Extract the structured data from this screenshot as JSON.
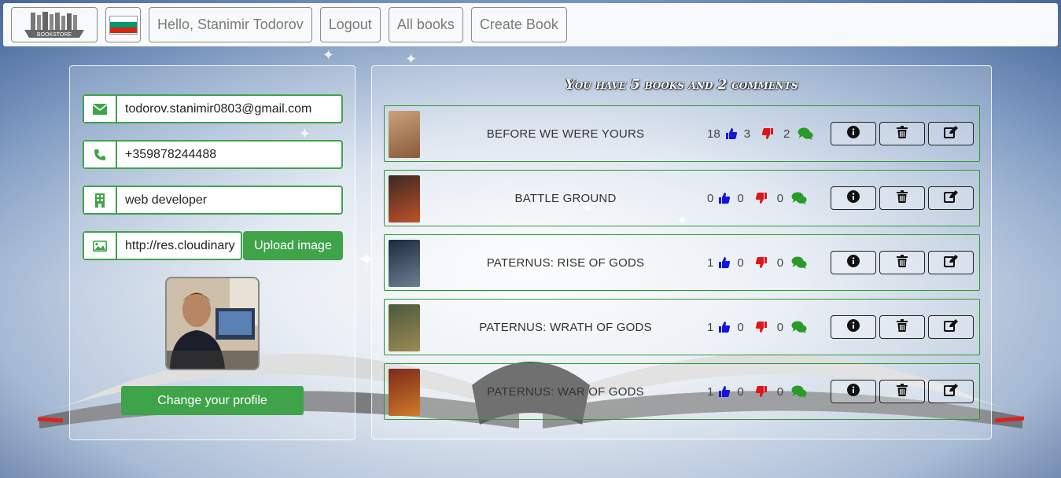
{
  "navbar": {
    "logo_text": "BOOKSTORE",
    "language_flag": "bulgaria-flag",
    "greeting": "Hello, Stanimir Todorov",
    "logout_label": "Logout",
    "all_books_label": "All books",
    "create_book_label": "Create Book"
  },
  "profile": {
    "email": "todorov.stanimir0803@gmail.com",
    "phone": "+359878244488",
    "job": "web developer",
    "image_url": "http://res.cloudinary",
    "upload_label": "Upload image",
    "change_profile_label": "Change your profile",
    "icons": [
      "envelope-icon",
      "phone-icon",
      "building-icon",
      "image-icon"
    ]
  },
  "books_summary": "You have 5 books and 2 comments",
  "books": [
    {
      "title": "BEFORE WE WERE YOURS",
      "views": "18",
      "likes": "3",
      "dislikes": "2",
      "cover_colors": [
        "#c9a27a",
        "#8a5a3a"
      ]
    },
    {
      "title": "BATTLE GROUND",
      "views": "0",
      "likes": "0",
      "dislikes": "0",
      "cover_colors": [
        "#3a2a22",
        "#c0502a"
      ]
    },
    {
      "title": "PATERNUS: RISE OF GODS",
      "views": "1",
      "likes": "0",
      "dislikes": "0",
      "cover_colors": [
        "#1c2a3e",
        "#6f7f92"
      ]
    },
    {
      "title": "PATERNUS: WRATH OF GODS",
      "views": "1",
      "likes": "0",
      "dislikes": "0",
      "cover_colors": [
        "#4a5a3a",
        "#9c8a56"
      ]
    },
    {
      "title": "PATERNUS: WAR OF GODS",
      "views": "1",
      "likes": "0",
      "dislikes": "0",
      "cover_colors": [
        "#7a2a1a",
        "#d07a2a"
      ]
    }
  ],
  "colors": {
    "accent_green": "#3fa34a",
    "like_blue": "#1414e0",
    "dislike_red": "#e01414",
    "comment_green": "#2a9a2a"
  }
}
